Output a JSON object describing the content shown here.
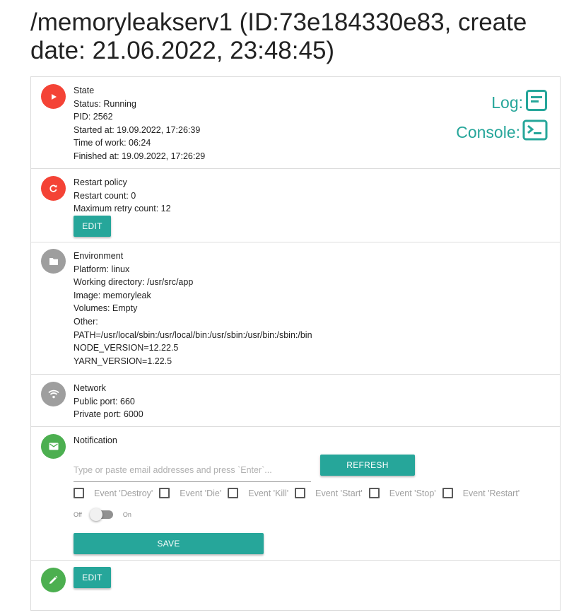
{
  "title": "/memoryleakserv1 (ID:73e184330e83, create date: 21.06.2022, 23:48:45)",
  "state": {
    "heading": "State",
    "status": "Status: Running",
    "pid": "PID: 2562",
    "started": "Started at: 19.09.2022, 17:26:39",
    "time_of_work": "Time of work: 06:24",
    "finished": "Finished at: 19.09.2022, 17:26:29",
    "log_label": "Log:",
    "console_label": "Console:"
  },
  "restart": {
    "heading": "Restart policy",
    "restart_count": "Restart count: 0",
    "max_retry": "Maximum retry count: 12",
    "edit_label": "EDIT"
  },
  "environment": {
    "heading": "Environment",
    "platform": "Platform: linux",
    "workdir": "Working directory: /usr/src/app",
    "image": "Image: memoryleak",
    "volumes": "Volumes: Empty",
    "other": "Other:",
    "env_vars": [
      "PATH=/usr/local/sbin:/usr/local/bin:/usr/sbin:/usr/bin:/sbin:/bin",
      "NODE_VERSION=12.22.5",
      "YARN_VERSION=1.22.5"
    ]
  },
  "network": {
    "heading": "Network",
    "public_port": "Public port: 660",
    "private_port": "Private port: 6000"
  },
  "notification": {
    "heading": "Notification",
    "email_placeholder": "Type or paste email addresses and press `Enter`...",
    "refresh_label": "REFRESH",
    "events": [
      "Event 'Destroy'",
      "Event 'Die'",
      "Event 'Kill'",
      "Event 'Start'",
      "Event 'Stop'",
      "Event 'Restart'"
    ],
    "switch_off": "Off",
    "switch_on": "On",
    "switch_state": "off",
    "save_label": "SAVE"
  },
  "footer": {
    "edit_label": "EDIT"
  },
  "colors": {
    "accent": "#26a69a",
    "red": "#f44336",
    "grey": "#9e9e9e",
    "green": "#4caf50"
  },
  "icons": {
    "state": "play-icon",
    "restart": "refresh-icon",
    "environment": "folder-icon",
    "network": "wifi-icon",
    "notification": "mail-icon",
    "footer": "pencil-icon",
    "log": "log-icon",
    "console": "console-icon"
  }
}
